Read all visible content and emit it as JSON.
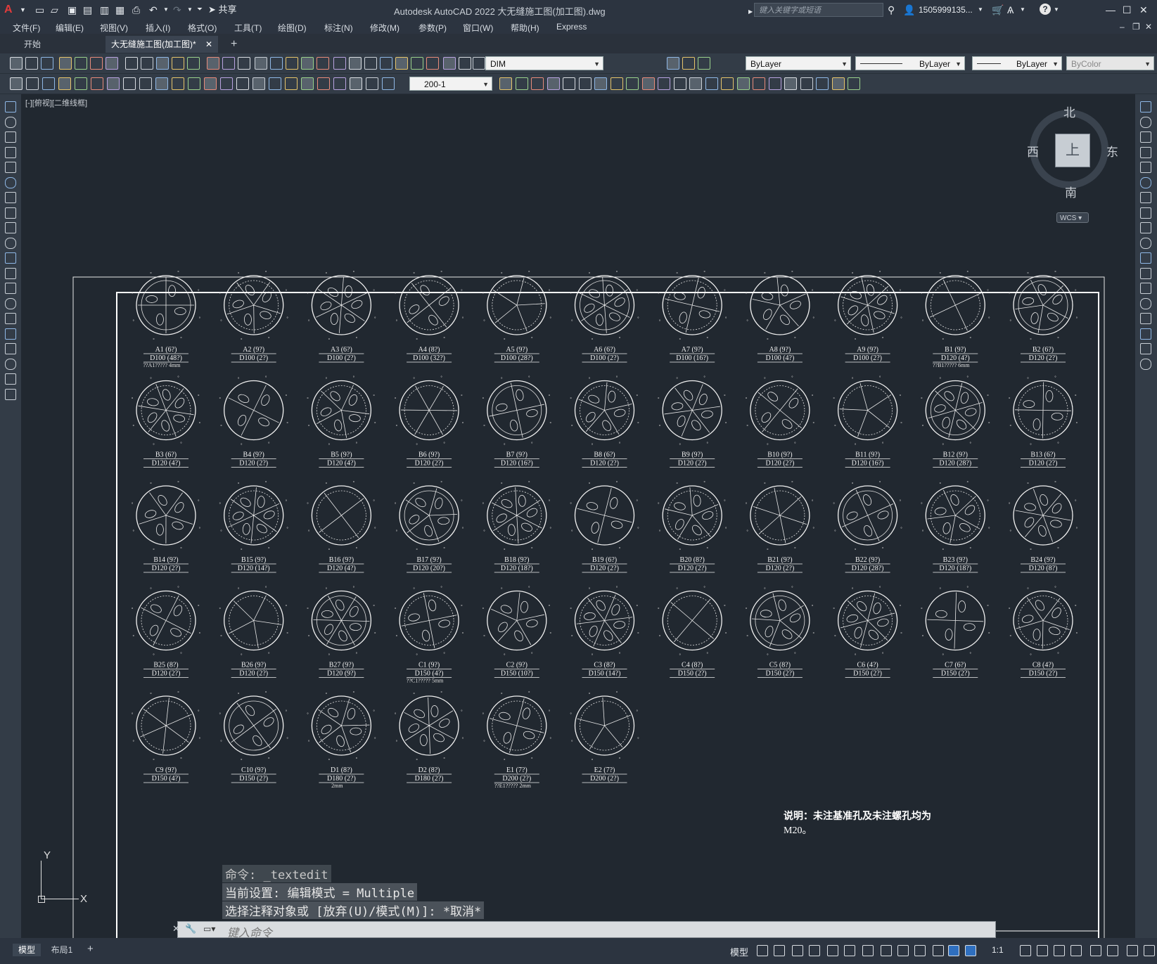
{
  "app": {
    "title": "Autodesk AutoCAD 2022    大无缝施工图(加工图).dwg",
    "share_label": "共享",
    "search_placeholder": "键入关键字或短语",
    "user": "1505999135..."
  },
  "menu": [
    "文件(F)",
    "编辑(E)",
    "视图(V)",
    "插入(I)",
    "格式(O)",
    "工具(T)",
    "绘图(D)",
    "标注(N)",
    "修改(M)",
    "参数(P)",
    "窗口(W)",
    "帮助(H)",
    "Express"
  ],
  "tabs": [
    {
      "label": "开始",
      "active": false
    },
    {
      "label": "大无缝施工图(加工图)*",
      "active": true
    }
  ],
  "toolbar": {
    "dim_style": "DIM",
    "layer": "ByLayer",
    "linetype": "ByLayer",
    "lineweight": "ByLayer",
    "plotstyle": "ByColor",
    "scale": "200-1"
  },
  "viewport": {
    "label": "[-][俯视][二维线框]",
    "compass": {
      "north": "北",
      "south": "南",
      "east": "东",
      "west": "西",
      "top": "上"
    },
    "wcs": "WCS",
    "axis_x": "X",
    "axis_y": "Y"
  },
  "drawing": {
    "rows": [
      [
        [
          "A1 (6?)",
          "D100 (48?)"
        ],
        [
          "A2 (9?)",
          "D100 (2?)"
        ],
        [
          "A3 (6?)",
          "D100 (2?)"
        ],
        [
          "A4 (8?)",
          "D100 (32?)"
        ],
        [
          "A5 (9?)",
          "D100 (28?)"
        ],
        [
          "A6 (6?)",
          "D100 (2?)"
        ],
        [
          "A7 (9?)",
          "D100 (16?)"
        ],
        [
          "A8 (9?)",
          "D100 (4?)"
        ],
        [
          "A9 (9?)",
          "D100 (2?)"
        ],
        [
          "B1 (9?)",
          "D120 (4?)"
        ],
        [
          "B2 (6?)",
          "D120 (2?)"
        ]
      ],
      [
        [
          "B3 (6?)",
          "D120 (4?)"
        ],
        [
          "B4 (9?)",
          "D120 (2?)"
        ],
        [
          "B5 (9?)",
          "D120 (4?)"
        ],
        [
          "B6 (9?)",
          "D120 (2?)"
        ],
        [
          "B7 (9?)",
          "D120 (16?)"
        ],
        [
          "B8 (6?)",
          "D120 (2?)"
        ],
        [
          "B9 (9?)",
          "D120 (2?)"
        ],
        [
          "B10 (9?)",
          "D120 (2?)"
        ],
        [
          "B11 (9?)",
          "D120 (16?)"
        ],
        [
          "B12 (9?)",
          "D120 (28?)"
        ],
        [
          "B13 (6?)",
          "D120 (2?)"
        ]
      ],
      [
        [
          "B14 (9?)",
          "D120 (2?)"
        ],
        [
          "B15 (9?)",
          "D120 (14?)"
        ],
        [
          "B16 (9?)",
          "D120 (4?)"
        ],
        [
          "B17 (9?)",
          "D120 (20?)"
        ],
        [
          "B18 (9?)",
          "D120 (18?)"
        ],
        [
          "B19 (6?)",
          "D120 (2?)"
        ],
        [
          "B20 (8?)",
          "D120 (2?)"
        ],
        [
          "B21 (9?)",
          "D120 (2?)"
        ],
        [
          "B22 (9?)",
          "D120 (28?)"
        ],
        [
          "B23 (9?)",
          "D120 (18?)"
        ],
        [
          "B24 (9?)",
          "D120 (8?)"
        ]
      ],
      [
        [
          "B25 (8?)",
          "D120 (2?)"
        ],
        [
          "B26 (9?)",
          "D120 (2?)"
        ],
        [
          "B27 (9?)",
          "D120 (9?)"
        ],
        [
          "C1 (9?)",
          "D150 (4?)"
        ],
        [
          "C2 (9?)",
          "D150 (10?)"
        ],
        [
          "C3 (8?)",
          "D150 (14?)"
        ],
        [
          "C4 (8?)",
          "D150 (2?)"
        ],
        [
          "C5 (8?)",
          "D150 (2?)"
        ],
        [
          "C6 (4?)",
          "D150 (2?)"
        ],
        [
          "C7 (6?)",
          "D150 (2?)"
        ],
        [
          "C8 (4?)",
          "D150 (2?)"
        ]
      ],
      [
        [
          "C9 (9?)",
          "D150 (4?)"
        ],
        [
          "C10 (9?)",
          "D150 (2?)"
        ],
        [
          "D1 (8?)",
          "D180 (2?)"
        ],
        [
          "D2 (8?)",
          "D180 (2?)"
        ],
        [
          "E1 (7?)",
          "D200 (2?)"
        ],
        [
          "E2 (7?)",
          "D200 (2?)"
        ]
      ]
    ],
    "notes": {
      "A1": "??A1????? 4mm",
      "B1": "??B1????? 6mm",
      "C1": "??C1????? 5mm",
      "D1": "2mm",
      "E1": "??E1????? 2mm"
    },
    "description_line1": "说明：未注基准孔及未注螺孔均为",
    "description_line2": "M20。"
  },
  "command": {
    "line1": "命令: _textedit",
    "line2": "当前设置: 编辑模式 = Multiple",
    "line3": "选择注释对象或 [放弃(U)/模式(M)]: *取消*",
    "placeholder": "键入命令"
  },
  "status": {
    "tab_model": "模型",
    "tab_layout": "布局1",
    "add_tab": "+",
    "model_label": "模型",
    "scale": "1:1"
  }
}
